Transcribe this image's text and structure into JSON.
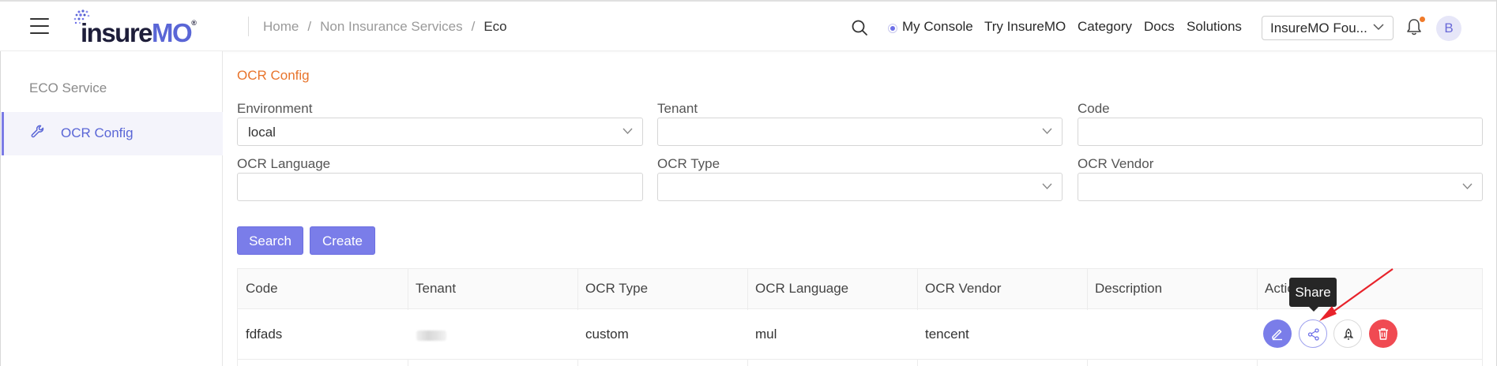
{
  "header": {
    "logo_text": "insureMO",
    "breadcrumb": [
      "Home",
      "Non Insurance Services",
      "Eco"
    ],
    "nav": {
      "console": "My Console",
      "try": "Try InsureMO",
      "category": "Category",
      "docs": "Docs",
      "solutions": "Solutions"
    },
    "tenant_select": "InsureMO Fou...",
    "avatar_letter": "B",
    "accent_color": "#6d6fe8",
    "notification_dot_color": "#f07a2a"
  },
  "sidebar": {
    "title": "ECO Service",
    "items": [
      {
        "label": "OCR Config",
        "icon": "wrench-icon",
        "active": true
      }
    ]
  },
  "main": {
    "page_title": "OCR Config",
    "filters": {
      "environment": {
        "label": "Environment",
        "value": "local"
      },
      "tenant": {
        "label": "Tenant",
        "value": ""
      },
      "code": {
        "label": "Code",
        "value": ""
      },
      "ocr_language": {
        "label": "OCR Language",
        "value": ""
      },
      "ocr_type": {
        "label": "OCR Type",
        "value": ""
      },
      "ocr_vendor": {
        "label": "OCR Vendor",
        "value": ""
      }
    },
    "buttons": {
      "search": "Search",
      "create": "Create"
    },
    "table": {
      "columns": [
        "Code",
        "Tenant",
        "OCR Type",
        "OCR Language",
        "OCR Vendor",
        "Description",
        "Action"
      ],
      "rows": [
        {
          "code": "fdfads",
          "tenant": "",
          "ocr_type": "custom",
          "ocr_language": "mul",
          "ocr_vendor": "tencent",
          "description": ""
        }
      ]
    },
    "tooltip": "Share",
    "action_icons": [
      "edit-icon",
      "share-icon",
      "rocket-icon",
      "trash-icon"
    ],
    "delete_color": "#f04a52",
    "title_color": "#e8742c"
  }
}
